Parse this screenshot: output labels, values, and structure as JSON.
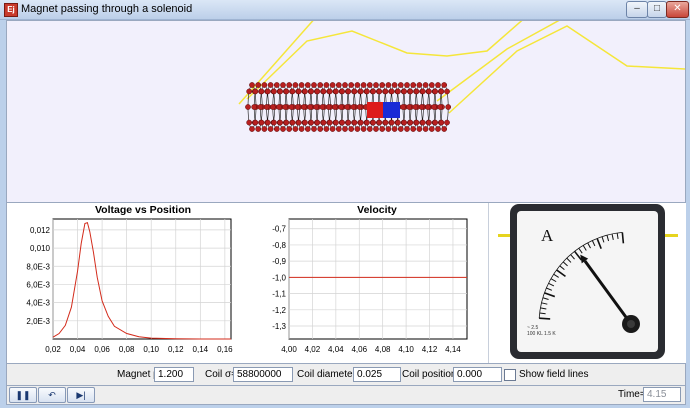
{
  "window": {
    "title": "Magnet passing through a solenoid",
    "app_icon": "Ej",
    "buttons": {
      "minimize": "–",
      "maximize": "□",
      "close": "✕"
    }
  },
  "colors": {
    "field_line": "#f5e63a",
    "coil_bead": "#b81f1f",
    "magnet_north": "#dd1b1b",
    "magnet_south": "#1a2bd6",
    "plot_line": "#d32b1b",
    "scene_bg": "#f2f0fc",
    "meter_pointer": "#111111"
  },
  "charts": [
    {
      "title": "Voltage vs Position",
      "chart_data": {
        "type": "line",
        "title": "Voltage vs Position",
        "x_ticks": [
          "0,02",
          "0,04",
          "0,06",
          "0,08",
          "0,10",
          "0,12",
          "0,14",
          "0,16"
        ],
        "y_ticks": [
          "0,012",
          "0,010",
          "8,0E-3",
          "6,0E-3",
          "4,0E-3",
          "2,0E-3"
        ],
        "xlim": [
          0.02,
          0.165
        ],
        "ylim": [
          0,
          0.0132
        ],
        "grid": true,
        "series": [
          {
            "values": [
              [
                0.02,
                0.0002
              ],
              [
                0.025,
                0.0006
              ],
              [
                0.03,
                0.0015
              ],
              [
                0.035,
                0.0035
              ],
              [
                0.04,
                0.0075
              ],
              [
                0.043,
                0.0105
              ],
              [
                0.046,
                0.0127
              ],
              [
                0.048,
                0.0128
              ],
              [
                0.05,
                0.0118
              ],
              [
                0.053,
                0.0095
              ],
              [
                0.056,
                0.0068
              ],
              [
                0.06,
                0.0042
              ],
              [
                0.065,
                0.0025
              ],
              [
                0.07,
                0.0014
              ],
              [
                0.08,
                0.0006
              ],
              [
                0.09,
                0.00025
              ],
              [
                0.1,
                0.0001
              ],
              [
                0.12,
                3e-05
              ],
              [
                0.14,
                0.0
              ],
              [
                0.165,
                0.0
              ]
            ]
          }
        ]
      }
    },
    {
      "title": "Velocity",
      "chart_data": {
        "type": "line",
        "title": "Velocity",
        "x_ticks": [
          "4,00",
          "4,02",
          "4,04",
          "4,06",
          "4,08",
          "4,10",
          "4,12",
          "4,14"
        ],
        "y_ticks": [
          "-0,7",
          "-0,8",
          "-0,9",
          "-1,0",
          "-1,1",
          "-1,2",
          "-1,3"
        ],
        "xlim": [
          4.0,
          4.152
        ],
        "ylim": [
          -1.38,
          -0.64
        ],
        "grid": true,
        "series": [
          {
            "values": [
              [
                4.0,
                -1.0
              ],
              [
                4.152,
                -1.0
              ]
            ]
          }
        ]
      }
    }
  ],
  "meter": {
    "unit_label": "A",
    "fine_print": [
      "~ 2.5",
      "100 KL 1.5 K"
    ],
    "pointer_value": 0.62
  },
  "controls": {
    "magnet_mu": {
      "label": "Magnet μ=",
      "value": "1.200"
    },
    "coil_sigma": {
      "label": "Coil σ=",
      "value": "58800000"
    },
    "coil_diameter": {
      "label": "Coil diameter=",
      "value": "0.025"
    },
    "coil_position": {
      "label": "Coil position=",
      "value": "0.000"
    },
    "show_field_lines": {
      "label": "Show field lines",
      "checked": false
    }
  },
  "playback": {
    "pause": "❚❚",
    "reset": "↶",
    "step": "▶|"
  },
  "time": {
    "label": "Time=",
    "value": "4.15"
  }
}
